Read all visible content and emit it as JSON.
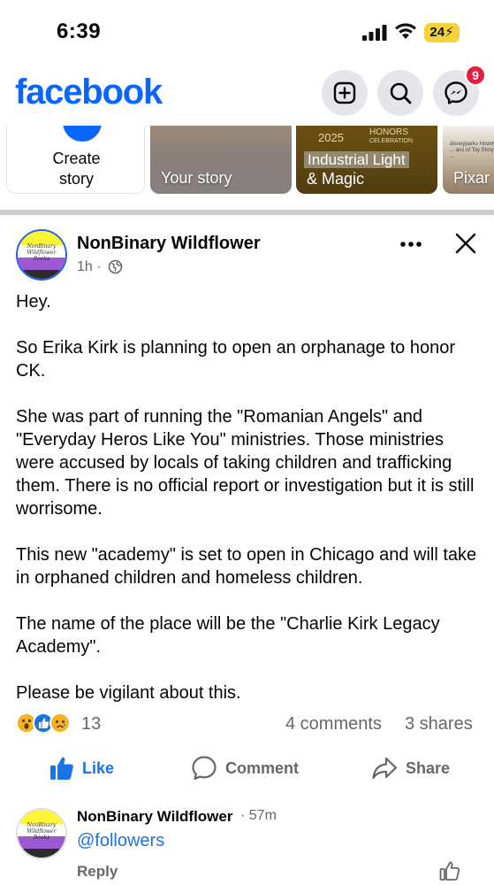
{
  "status_bar": {
    "time": "6:39",
    "battery": "24"
  },
  "header": {
    "logo": "facebook",
    "buttons": [
      "plus-square-icon",
      "search-icon",
      "messenger-icon"
    ],
    "messenger_badge": "9",
    "brand_color": "#0866ff"
  },
  "stories": {
    "create_label": "Create story",
    "items": [
      {
        "label": "Your story"
      },
      {
        "label_line1": "Industrial Light",
        "label_line2": "& Magic",
        "year": "2025",
        "honors": "HONORS",
        "honors_sub": "CELEBRATION"
      },
      {
        "label": "Pixar",
        "tiny_text": "disneyparks Howdy, y ... ans of Toy Story is ..."
      }
    ]
  },
  "post": {
    "author": "NonBinary Wildflower",
    "time": "1h",
    "meta_sep": "·",
    "avatar_text": "NonBinary Wildflower Books",
    "paragraphs": [
      "Hey.",
      "So Erika Kirk is planning to open an orphanage to honor CK.",
      "She was part of running the \"Romanian Angels\" and \"Everyday Heros Like You\" ministries. Those ministries were accused by locals of taking children and trafficking them. There is no official report or investigation but it is still worrisome.",
      "This new \"academy\" is set to open in Chicago and will take in orphaned children and homeless children.",
      "The name of the place will be the \"Charlie Kirk Legacy Academy\".",
      "Please be vigilant about this."
    ],
    "reactions": [
      "wow",
      "like",
      "sad"
    ],
    "reaction_count": "13",
    "comments": "4 comments",
    "shares": "3 shares"
  },
  "actions": {
    "like": "Like",
    "comment": "Comment",
    "share": "Share",
    "like_color": "#1b74e4"
  },
  "comment": {
    "author": "NonBinary Wildflower",
    "time": "· 57m",
    "text": "@followers",
    "reply": "Reply"
  }
}
